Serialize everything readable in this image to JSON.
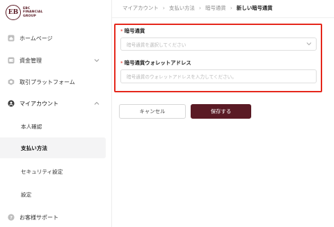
{
  "brand": {
    "logo_letters": "EB",
    "name_line1": "EBC",
    "name_line2": "FINANCIAL",
    "name_line3": "GROUP",
    "color": "#5a1a24"
  },
  "sidebar": {
    "items": [
      {
        "label": "ホームページ",
        "icon": "home-icon"
      },
      {
        "label": "資金管理",
        "icon": "wallet-icon"
      },
      {
        "label": "取引プラットフォーム",
        "icon": "platform-icon"
      },
      {
        "label": "マイアカウント",
        "icon": "user-icon"
      }
    ],
    "sub_items": [
      {
        "label": "本人確認"
      },
      {
        "label": "支払い方法",
        "active": true
      },
      {
        "label": "セキュリティ設定"
      },
      {
        "label": "設定"
      }
    ],
    "support": {
      "label": "お客様サポート",
      "icon": "help-icon"
    }
  },
  "breadcrumb": {
    "items": [
      "マイアカウント",
      "支払い方法",
      "暗号通貨"
    ],
    "current": "新しい暗号通貨"
  },
  "form": {
    "crypto": {
      "required_mark": "*",
      "label": "暗号通貨",
      "placeholder": "暗号通貨を選択してください"
    },
    "wallet": {
      "required_mark": "*",
      "label": "暗号通貨ウォレットアドレス",
      "placeholder": "暗号通貨のウォレットアドレスを入力してください。"
    },
    "highlight_color": "#e5261a"
  },
  "actions": {
    "cancel_label": "キャンセル",
    "save_label": "保存する"
  }
}
